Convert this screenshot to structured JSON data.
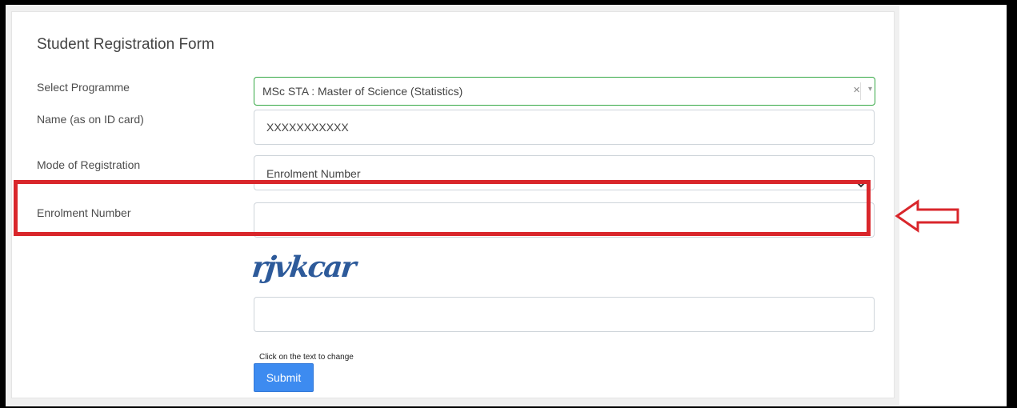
{
  "form": {
    "title": "Student Registration Form",
    "programme": {
      "label": "Select Programme",
      "value": "MSc STA : Master of Science (Statistics)",
      "clear_symbol": "×",
      "arrow_symbol": "▾"
    },
    "name": {
      "label": "Name (as on ID card)",
      "value": "XXXXXXXXXXX"
    },
    "mode": {
      "label": "Mode of Registration",
      "selected": "Enrolment Number"
    },
    "enrolment": {
      "label": "Enrolment Number",
      "value": ""
    },
    "captcha": {
      "text": "rjvkcar",
      "input_value": "",
      "hint": "Click on the text to change"
    },
    "submit_label": "Submit"
  },
  "annotation": {
    "highlight_color": "#d9262b",
    "arrow_icon": "left-arrow-outline-icon"
  }
}
